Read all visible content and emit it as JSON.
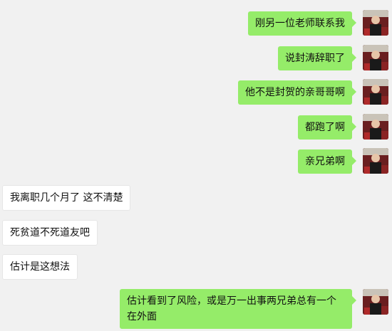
{
  "messages": [
    {
      "dir": "out",
      "text": "刚另一位老师联系我"
    },
    {
      "dir": "out",
      "text": "说封涛辞职了"
    },
    {
      "dir": "out",
      "text": "他不是封贺的亲哥哥啊"
    },
    {
      "dir": "out",
      "text": "都跑了啊"
    },
    {
      "dir": "out",
      "text": "亲兄弟啊"
    },
    {
      "dir": "in",
      "text": "我离职几个月了 这不清楚"
    },
    {
      "dir": "in",
      "text": "死贫道不死道友吧"
    },
    {
      "dir": "in",
      "text": "估计是这想法"
    },
    {
      "dir": "out",
      "text": "估计看到了风险，或是万一出事两兄弟总有一个在外面"
    }
  ],
  "colors": {
    "background": "#f1f1f1",
    "outgoing_bubble": "#95ec69",
    "incoming_bubble": "#ffffff"
  },
  "icons": {
    "avatar": "user-avatar-photo"
  }
}
